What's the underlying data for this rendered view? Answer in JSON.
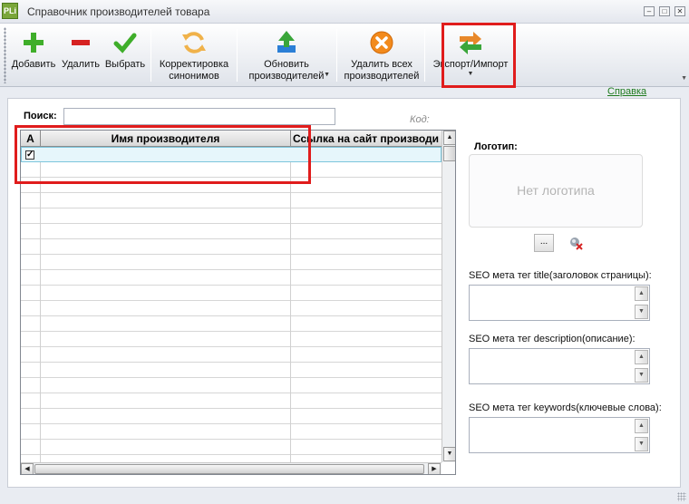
{
  "window": {
    "app_icon": "PLi",
    "title": "Справочник производителей товара"
  },
  "toolbar": {
    "add_label": "Добавить",
    "delete_label": "Удалить",
    "select_label": "Выбрать",
    "synonyms_label": "Корректировка\nсинонимов",
    "refresh_label": "Обновить\nпроизводителей",
    "delete_all_label": "Удалить всех\nпроизводителей",
    "export_import_label": "Экспорт/Импорт",
    "icons": {
      "add": "plus-icon",
      "delete": "minus-icon",
      "select": "checkmark-icon",
      "synonyms": "refresh-icon",
      "refresh": "upload-arrow-icon",
      "delete_all": "cancel-icon",
      "export_import": "swap-arrows-icon"
    }
  },
  "help_link": "Справка",
  "search": {
    "label": "Поиск:",
    "value": "",
    "code_label": "Код:"
  },
  "grid": {
    "columns": [
      "A",
      "Имя производителя",
      "Ссылка на сайт производи"
    ],
    "rows": [
      {
        "checked": true,
        "name": "",
        "url": ""
      }
    ]
  },
  "logo": {
    "label": "Логотип:",
    "placeholder": "Нет логотипа",
    "browse_label": "..."
  },
  "seo": {
    "title_label": "SEO мета тег title(заголовок страницы):",
    "description_label": "SEO мета тег description(описание):",
    "keywords_label": "SEO мета тег keywords(ключевые слова):"
  },
  "colors": {
    "highlight": "#e01c1c",
    "help_link": "#1e7a1e",
    "selected_row": "#e6f6fb"
  }
}
